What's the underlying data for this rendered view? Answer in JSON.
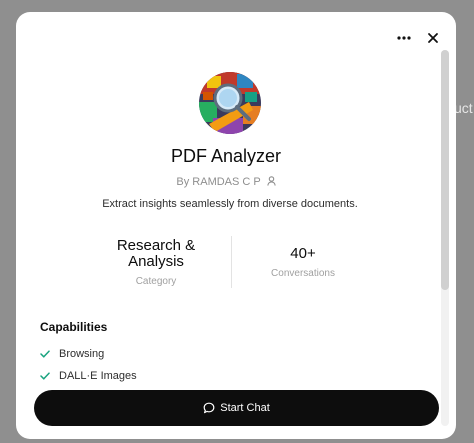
{
  "backdrop": {
    "partial_text": "uct"
  },
  "modal": {
    "title": "PDF Analyzer",
    "author": "By RAMDAS C P",
    "description": "Extract insights seamlessly from diverse documents.",
    "stats": {
      "category": {
        "value": "Research & Analysis",
        "label": "Category"
      },
      "conversations": {
        "value": "40+",
        "label": "Conversations"
      }
    },
    "capabilities": {
      "heading": "Capabilities",
      "items": [
        "Browsing",
        "DALL·E Images"
      ]
    },
    "start_button": {
      "label": "Start Chat"
    },
    "icons": {
      "more": "more-options-icon",
      "close": "close-icon",
      "author": "person-icon",
      "check": "check-icon",
      "chat": "chat-bubble-icon"
    },
    "colors": {
      "check": "#19a37f",
      "button_bg": "#0d0d0d",
      "backdrop": "#8f8f8f"
    }
  }
}
